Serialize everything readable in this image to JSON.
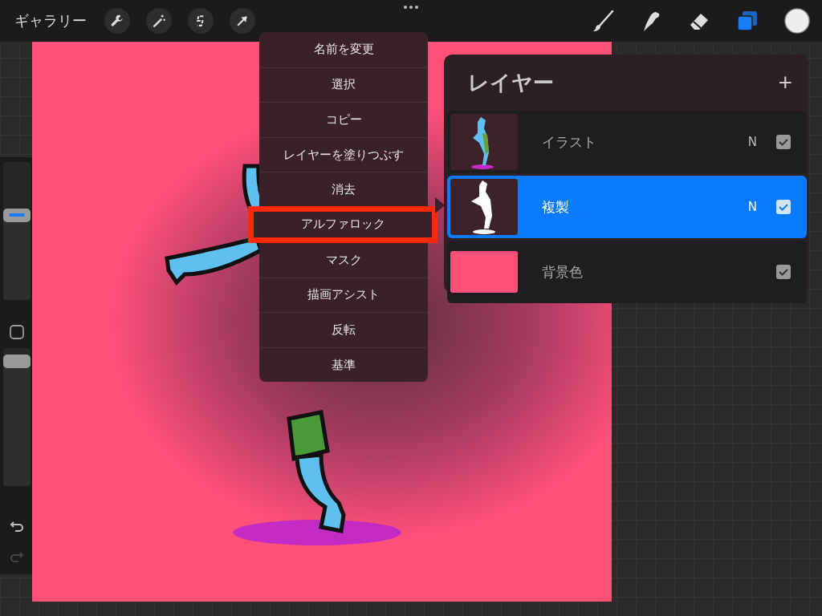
{
  "toolbar": {
    "gallery": "ギャラリー",
    "tools": [
      {
        "kind": "wrench",
        "selected": false
      },
      {
        "kind": "wand",
        "selected": false
      },
      {
        "kind": "selection",
        "selected": false
      },
      {
        "kind": "arrow",
        "selected": false
      },
      {
        "kind": "brush",
        "selected": false
      },
      {
        "kind": "smudge",
        "selected": false
      },
      {
        "kind": "eraser",
        "selected": false
      },
      {
        "kind": "layers",
        "selected": true
      },
      {
        "kind": "color",
        "selected": false
      }
    ]
  },
  "sidebar": {
    "size_slider": {
      "level": 0.63
    },
    "opacity_slider": {
      "level": 0.92
    }
  },
  "layer_menu": {
    "items": [
      {
        "label": "名前を変更",
        "highlighted": false
      },
      {
        "label": "選択",
        "highlighted": false
      },
      {
        "label": "コピー",
        "highlighted": false
      },
      {
        "label": "レイヤーを塗りつぶす",
        "highlighted": false
      },
      {
        "label": "消去",
        "highlighted": false
      },
      {
        "label": "アルファロック",
        "highlighted": true
      },
      {
        "label": "マスク",
        "highlighted": false
      },
      {
        "label": "描画アシスト",
        "highlighted": false
      },
      {
        "label": "反転",
        "highlighted": false
      },
      {
        "label": "基準",
        "highlighted": false
      }
    ]
  },
  "layers_panel": {
    "title": "レイヤー",
    "add_button": "+",
    "layers": [
      {
        "name": "イラスト",
        "kind": "figure",
        "blend_mode": "N",
        "visible": true,
        "selected": false
      },
      {
        "name": "複製",
        "kind": "silhouette",
        "blend_mode": "N",
        "visible": true,
        "selected": true
      },
      {
        "name": "背景色",
        "kind": "fill",
        "visible": true,
        "selected": false
      }
    ]
  }
}
